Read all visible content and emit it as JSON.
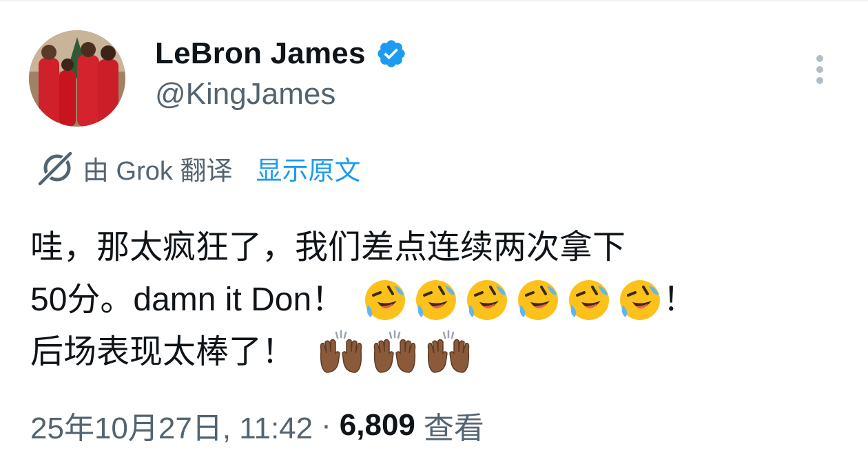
{
  "author": {
    "display_name": "LeBron James",
    "handle": "@KingJames",
    "verified": true,
    "avatar_icon": "profile-photo"
  },
  "translation": {
    "provider_text": "由 Grok 翻译",
    "show_original_label": "显示原文",
    "icon": "grok-icon"
  },
  "tweet": {
    "line1": "哇，那太疯狂了，我们差点连续两次拿下",
    "line2_text": "50分。damn it Don！",
    "line2_suffix": "！",
    "line3_text": "后场表现太棒了！",
    "laugh_emoji": "rolling-on-floor-laughing-icon",
    "laugh_emoji_count": 6,
    "hands_emoji": "raising-hands-icon",
    "hands_emoji_count": 3
  },
  "meta": {
    "timestamp": "25年10月27日, 11:42",
    "separator": "·",
    "views_count": "6,809",
    "views_label": "查看"
  },
  "colors": {
    "primary_text": "#0f1419",
    "secondary_text": "#536471",
    "link_blue": "#1d9bf0",
    "verified_blue": "#1d9bf0"
  }
}
